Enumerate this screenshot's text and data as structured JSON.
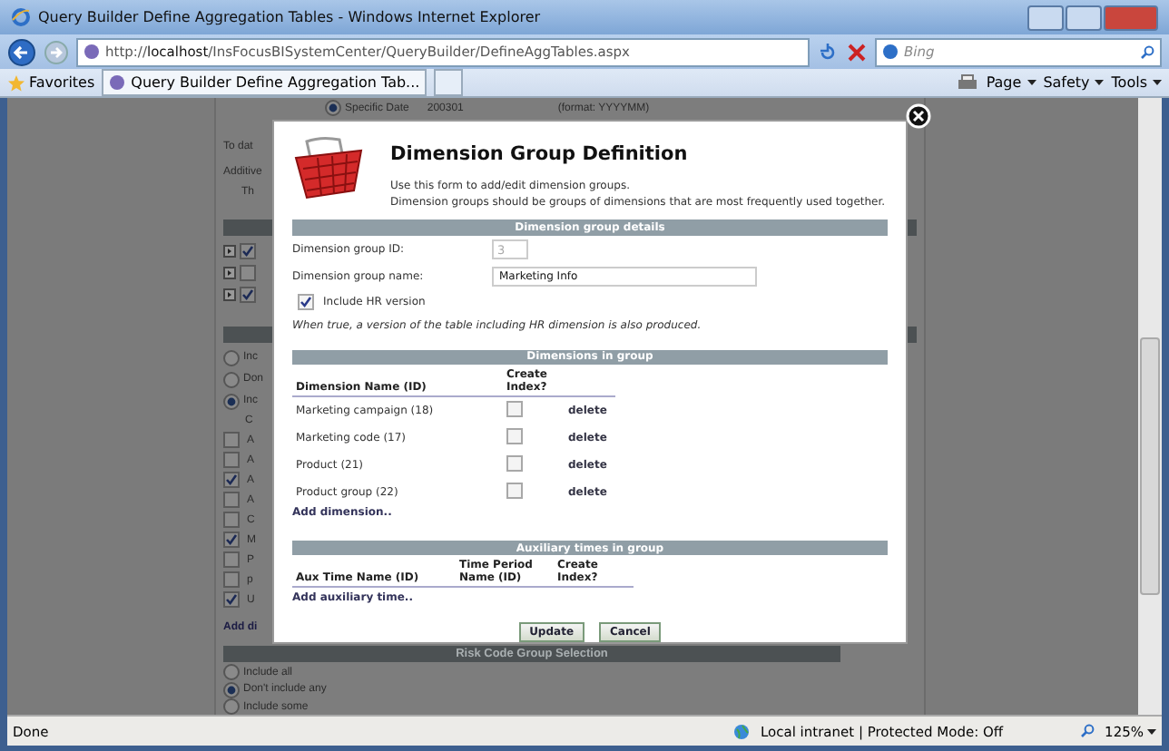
{
  "browser": {
    "title": "Query Builder Define Aggregation Tables - Windows Internet Explorer",
    "address": "http://**localhost**/InsFocusBISystemCenter/QueryBuilder/DefineAggTables.aspx",
    "search_placeholder": "Bing",
    "favorites": "Favorites",
    "tab": "Query Builder Define Aggregation Tab...",
    "commands": [
      "Page",
      "Safety",
      "Tools"
    ]
  },
  "background_page": {
    "date_option": {
      "label": "Specific Date",
      "value": "200301",
      "hint": "(format: YYYYMM)",
      "selected": true
    },
    "lines": [
      "To dat",
      "Additive",
      "Th"
    ],
    "tree": [
      {
        "checked": true
      },
      {
        "checked": false
      },
      {
        "checked": true
      }
    ],
    "radios": [
      {
        "label": "Inc",
        "selected": false
      },
      {
        "label": "Don",
        "selected": false
      },
      {
        "label": "Inc",
        "selected": true
      }
    ],
    "column_header": "C",
    "checks": [
      {
        "label": "A",
        "checked": false
      },
      {
        "label": "A",
        "checked": false
      },
      {
        "label": "A",
        "checked": true
      },
      {
        "label": "A",
        "checked": false
      },
      {
        "label": "C",
        "checked": false
      },
      {
        "label": "M",
        "checked": true
      },
      {
        "label": "P",
        "checked": false
      },
      {
        "label": "p",
        "checked": false
      },
      {
        "label": "U",
        "checked": true
      }
    ],
    "add_link": "Add di",
    "risk": {
      "title": "Risk Code Group Selection",
      "options": [
        {
          "label": "Include all",
          "selected": false
        },
        {
          "label": "Don't include any",
          "selected": true
        },
        {
          "label": "Include some",
          "selected": false
        }
      ]
    }
  },
  "dialog": {
    "title": "Dimension Group Definition",
    "description": [
      "Use this form to add/edit dimension groups.",
      "Dimension groups should be groups of dimensions that are most frequently used together."
    ],
    "details": {
      "title": "Dimension group details",
      "id_label": "Dimension group ID:",
      "id_value": "3",
      "name_label": "Dimension group name:",
      "name_value": "Marketing Info",
      "include_hr": {
        "label": "Include HR version",
        "checked": true
      },
      "note": "When true, a version of the table including HR dimension is also produced."
    },
    "dimensions": {
      "title": "Dimensions in group",
      "columns": [
        "Dimension Name (ID)",
        "Create Index?"
      ],
      "rows": [
        {
          "name": "Marketing campaign (18)",
          "create_index": false,
          "action": "delete"
        },
        {
          "name": "Marketing code (17)",
          "create_index": false,
          "action": "delete"
        },
        {
          "name": "Product (21)",
          "create_index": false,
          "action": "delete"
        },
        {
          "name": "Product group (22)",
          "create_index": false,
          "action": "delete"
        }
      ],
      "add_link": "Add dimension.."
    },
    "aux_times": {
      "title": "Auxiliary times in group",
      "columns": [
        "Aux Time Name (ID)",
        "Time Period Name (ID)",
        "Create Index?"
      ],
      "add_link": "Add auxiliary time.."
    },
    "buttons": [
      "Update",
      "Cancel"
    ]
  },
  "status_bar": {
    "text": "Done",
    "zone": "Local intranet | Protected Mode: Off",
    "zoom": "125%"
  }
}
